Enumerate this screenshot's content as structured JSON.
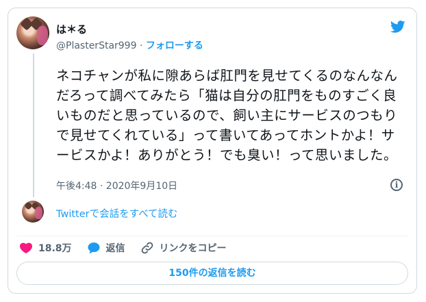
{
  "user": {
    "name": "は＊る",
    "handle": "@PlasterStar999",
    "separator": "·",
    "follow_label": "フォローする"
  },
  "tweet": {
    "text": "ネコチャンが私に隙あらば肛門を見せてくるのなんなんだろって調べてみたら「猫は自分の肛門をものすごく良いものだと思っているので、飼い主にサービスのつもりで見せてくれている」って書いてあってホントかよ！サービスかよ！ありがとう！でも臭い！って思いました。",
    "timestamp": "午後4:48 · 2020年9月10日"
  },
  "conversation_link": "Twitterで会話をすべて読む",
  "actions": {
    "like_count": "18.8万",
    "reply_label": "返信",
    "copy_link_label": "リンクをコピー"
  },
  "read_replies_label": "150件の返信を読む",
  "colors": {
    "accent": "#1d9bf0",
    "like": "#f91880",
    "muted": "#536471"
  },
  "icons": [
    "twitter-bird-icon",
    "info-icon",
    "heart-icon",
    "reply-bubble-icon",
    "link-icon"
  ]
}
